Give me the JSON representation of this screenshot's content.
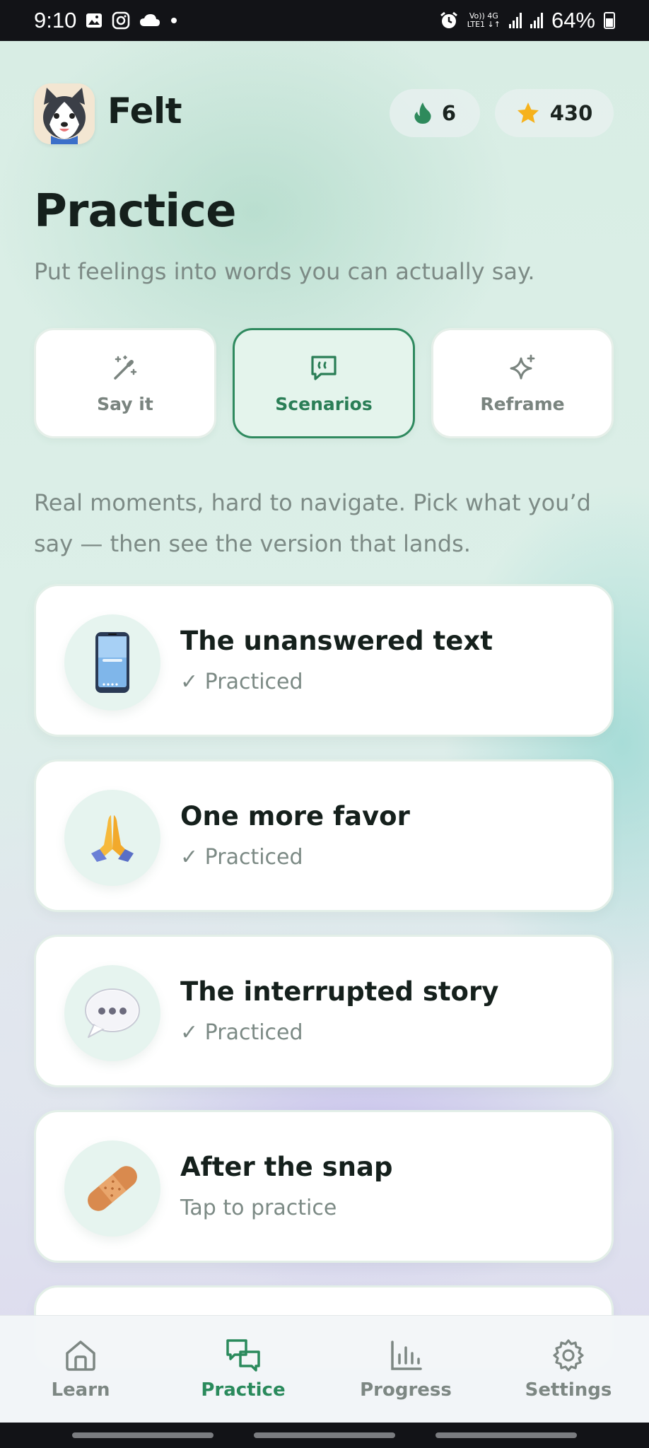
{
  "status_bar": {
    "time": "9:10",
    "net_top": "Vo)) 4G",
    "net_bottom": "LTE1 ↓↑",
    "battery": "64%"
  },
  "header": {
    "app_name": "Felt",
    "streak": "6",
    "stars": "430"
  },
  "page": {
    "title": "Practice",
    "subtitle": "Put feelings into words you can actually say."
  },
  "tabs": [
    {
      "label": "Say it",
      "icon": "magic-wand-icon",
      "selected": false
    },
    {
      "label": "Scenarios",
      "icon": "quote-bubble-icon",
      "selected": true
    },
    {
      "label": "Reframe",
      "icon": "sparkle-icon",
      "selected": false
    }
  ],
  "intro": "Real moments, hard to navigate. Pick what you’d say — then see the version that lands.",
  "scenarios": [
    {
      "title": "The unanswered text",
      "status": "✓ Practiced",
      "icon": "phone-emoji"
    },
    {
      "title": "One more favor",
      "status": "✓ Practiced",
      "icon": "praying-hands-emoji"
    },
    {
      "title": "The interrupted story",
      "status": "✓ Practiced",
      "icon": "speech-bubble-emoji"
    },
    {
      "title": "After the snap",
      "status": "Tap to practice",
      "icon": "bandage-emoji"
    }
  ],
  "nav": [
    {
      "label": "Learn",
      "icon": "home-icon",
      "active": false
    },
    {
      "label": "Practice",
      "icon": "chat-icon",
      "active": true
    },
    {
      "label": "Progress",
      "icon": "bar-chart-icon",
      "active": false
    },
    {
      "label": "Settings",
      "icon": "gear-icon",
      "active": false
    }
  ],
  "colors": {
    "accent": "#2f8a5f",
    "text": "#15201c",
    "muted": "#7c8a85"
  }
}
